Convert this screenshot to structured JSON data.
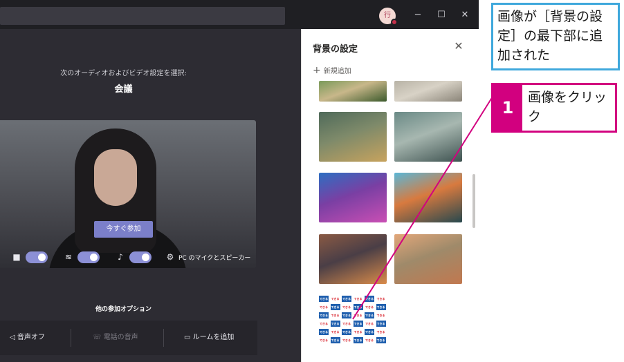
{
  "titlebar": {
    "avatar_initial": "行",
    "minimize_glyph": "−",
    "maximize_glyph": "☐",
    "close_glyph": "✕"
  },
  "prejoin": {
    "choose_text": "次のオーディオおよびビデオ設定を選択:",
    "meeting_title": "会議",
    "join_label": "今すぐ参加",
    "pc_audio_label": "PC のマイクとスピーカー",
    "other_options_label": "他の参加オプション",
    "options": [
      {
        "label": "音声オフ"
      },
      {
        "label": "電話の音声"
      },
      {
        "label": "ルームを追加"
      }
    ],
    "toggles": {
      "camera": true,
      "blur": true,
      "mic": true
    }
  },
  "panel": {
    "title": "背景の設定",
    "close_glyph": "✕",
    "add_new_label": "新規追加",
    "thumbnails": [
      {
        "name": "forest-path",
        "colors": [
          "#7a9a5a",
          "#3c5a2c",
          "#c8b78a"
        ]
      },
      {
        "name": "desert-ruins",
        "colors": [
          "#b8b3a6",
          "#8a8478",
          "#d8d2c6"
        ]
      },
      {
        "name": "fantasy-village",
        "colors": [
          "#4f6a5a",
          "#c7a35e",
          "#7e8a6a"
        ]
      },
      {
        "name": "scifi-world",
        "colors": [
          "#6a8a86",
          "#3e5250",
          "#a7b7b0"
        ]
      },
      {
        "name": "nebula",
        "colors": [
          "#2d6fc2",
          "#c94fb4",
          "#7a3fa3"
        ]
      },
      {
        "name": "pixel-landscape",
        "colors": [
          "#5bb7d7",
          "#27484e",
          "#d87a3f"
        ]
      },
      {
        "name": "autumn-street",
        "colors": [
          "#8a5a44",
          "#d98b4a",
          "#4a3e46"
        ]
      },
      {
        "name": "sunset-hills",
        "colors": [
          "#e2a77a",
          "#c1784f",
          "#9f8a6a"
        ]
      }
    ],
    "added_thumbnail": {
      "name": "logo-grid",
      "cells": [
        "できる",
        "できる",
        "できる",
        "できる",
        "できる",
        "できる"
      ],
      "colors": [
        "#1f5fae",
        "#d9262f"
      ]
    }
  },
  "callouts": {
    "result_note": "画像が［背景の設定］の最下部に追加された",
    "step_number": "1",
    "step_text": "画像をクリック"
  },
  "colors": {
    "accent": "#7b7fc9",
    "callout_blue": "#3fa8dc",
    "callout_magenta": "#d2007f"
  }
}
